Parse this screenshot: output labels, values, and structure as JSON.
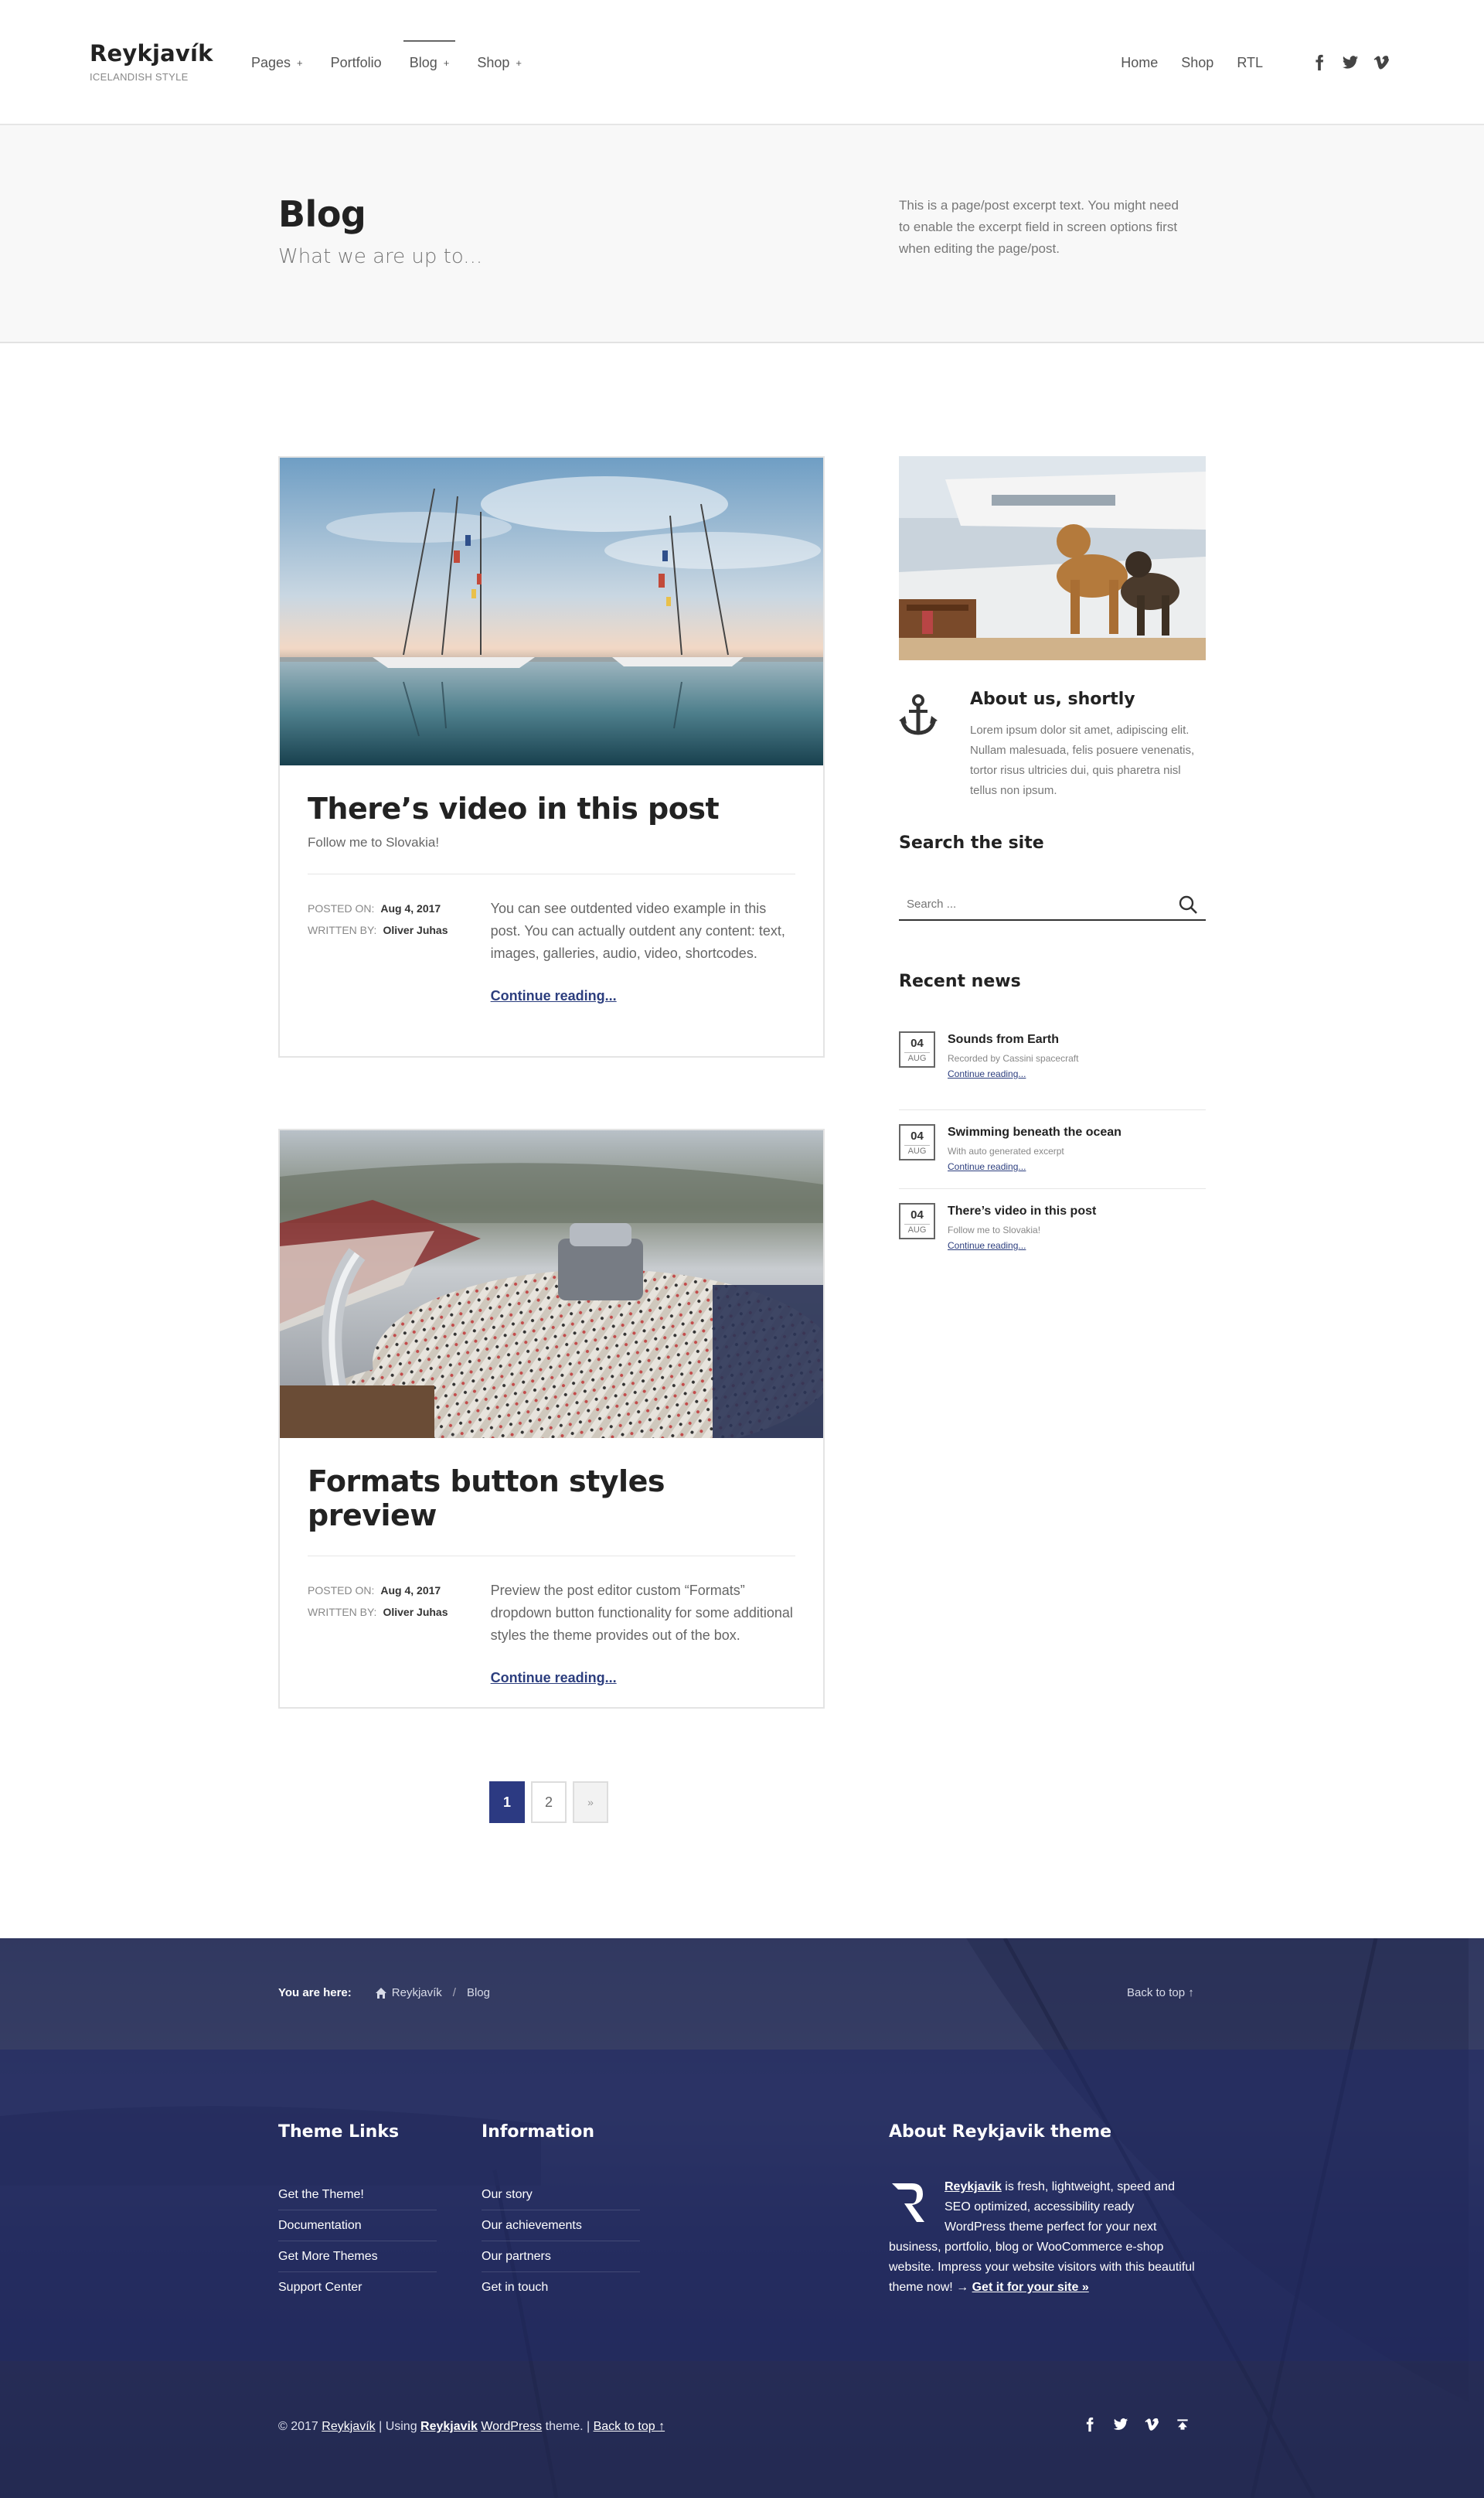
{
  "header": {
    "brand_name": "Reykjavík",
    "brand_tagline": "ICELANDISH STYLE",
    "nav": [
      {
        "label": "Pages",
        "has_sub": true
      },
      {
        "label": "Portfolio",
        "has_sub": false
      },
      {
        "label": "Blog",
        "has_sub": true
      },
      {
        "label": "Shop",
        "has_sub": true
      }
    ],
    "nav_sub_symbol": "+",
    "right_links": [
      "Home",
      "Shop",
      "RTL"
    ],
    "social_icons": [
      "facebook-icon",
      "twitter-icon",
      "vimeo-icon"
    ]
  },
  "intro": {
    "title": "Blog",
    "subtitle": "What we are up to...",
    "excerpt": "This is a page/post excerpt text. You might need to enable the excerpt field in screen options first when editing the page/post."
  },
  "posts": [
    {
      "title": "There’s video in this post",
      "subtitle": "Follow me to Slovakia!",
      "posted_label": "POSTED ON:",
      "posted_date": "Aug 4, 2017",
      "written_label": "WRITTEN BY:",
      "author": "Oliver Juhas",
      "excerpt": "You can see outdented video example in this post. You can actually outdent any content: text, images, galleries, audio, video, shortcodes.",
      "continue": "Continue reading..."
    },
    {
      "title": "Formats button styles preview",
      "subtitle": "",
      "posted_label": "POSTED ON:",
      "posted_date": "Aug 4, 2017",
      "written_label": "WRITTEN BY:",
      "author": "Oliver Juhas",
      "excerpt": "Preview the post editor custom “Formats” dropdown button functionality for some additional styles the theme provides out of the box.",
      "continue": "Continue reading..."
    }
  ],
  "pagination": {
    "current": "1",
    "second": "2",
    "next": "»"
  },
  "sidebar": {
    "about_title": "About us, shortly",
    "about_text": "Lorem ipsum dolor sit amet, adipiscing elit. Nullam malesuada, felis posuere venenatis, tortor risus ultricies dui, quis pharetra nisl tellus non ipsum.",
    "search_title": "Search the site",
    "search_placeholder": "Search ...",
    "news_title": "Recent news",
    "news": [
      {
        "day": "04",
        "month": "AUG",
        "title": "Sounds from Earth",
        "excerpt": "Recorded by Cassini spacecraft",
        "link": "Continue reading..."
      },
      {
        "day": "04",
        "month": "AUG",
        "title": "Swimming beneath the ocean",
        "excerpt": "With auto generated excerpt",
        "link": "Continue reading..."
      },
      {
        "day": "04",
        "month": "AUG",
        "title": "There’s video in this post",
        "excerpt": "Follow me to Slovakia!",
        "link": "Continue reading..."
      }
    ]
  },
  "footer": {
    "you_are_here": "You are here:",
    "crumb_home": "Reykjavík",
    "crumb_sep": "/",
    "crumb_current": "Blog",
    "back_to_top": "Back to top ↑",
    "theme_links_title": "Theme Links",
    "theme_links": [
      "Get the Theme!",
      "Documentation",
      "Get More Themes",
      "Support Center"
    ],
    "information_title": "Information",
    "information_links": [
      "Our story",
      "Our achievements",
      "Our partners",
      "Get in touch"
    ],
    "about_title": "About Reykjavik theme",
    "about_brand": "Reykjavik",
    "about_text": " is fresh, lightweight, speed and SEO optimized, accessibility ready WordPress theme perfect for your next business, portfolio, blog or WooCommerce e-shop website. Impress your website visitors with this beautiful theme now! → ",
    "about_cta": "Get it for your site »",
    "copy_prefix": "© 2017 ",
    "copy_brand": "Reykjavík",
    "copy_using": " | Using ",
    "copy_theme": "Reykjavik",
    "copy_wp": "WordPress",
    "copy_theme_suffix": " theme. | ",
    "copy_back": "Back to top ↑",
    "social_icons": [
      "facebook-icon",
      "twitter-icon",
      "vimeo-icon",
      "back-to-top-icon"
    ]
  },
  "colors": {
    "accent": "#2c3a82",
    "link": "#2c3e7e",
    "footer_bg": "#262d56"
  }
}
